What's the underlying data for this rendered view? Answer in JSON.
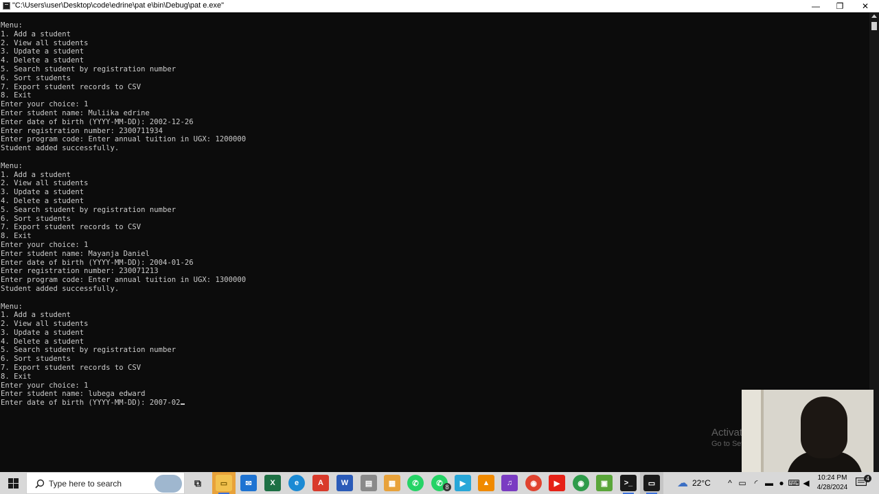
{
  "window": {
    "title": "\"C:\\Users\\user\\Desktop\\code\\edrine\\pat e\\bin\\Debug\\pat e.exe\"",
    "minimize": "—",
    "maximize": "❐",
    "close": "✕"
  },
  "console": {
    "lines": [
      "Menu:",
      "1. Add a student",
      "2. View all students",
      "3. Update a student",
      "4. Delete a student",
      "5. Search student by registration number",
      "6. Sort students",
      "7. Export student records to CSV",
      "8. Exit",
      "Enter your choice: 1",
      "Enter student name: Muliika edrine",
      "Enter date of birth (YYYY-MM-DD): 2002-12-26",
      "Enter registration number: 2300711934",
      "Enter program code: Enter annual tuition in UGX: 1200000",
      "Student added successfully.",
      "",
      "Menu:",
      "1. Add a student",
      "2. View all students",
      "3. Update a student",
      "4. Delete a student",
      "5. Search student by registration number",
      "6. Sort students",
      "7. Export student records to CSV",
      "8. Exit",
      "Enter your choice: 1",
      "Enter student name: Mayanja Daniel",
      "Enter date of birth (YYYY-MM-DD): 2004-01-26",
      "Enter registration number: 230071213",
      "Enter program code: Enter annual tuition in UGX: 1300000",
      "Student added successfully.",
      "",
      "Menu:",
      "1. Add a student",
      "2. View all students",
      "3. Update a student",
      "4. Delete a student",
      "5. Search student by registration number",
      "6. Sort students",
      "7. Export student records to CSV",
      "8. Exit",
      "Enter your choice: 1",
      "Enter student name: lubega edward"
    ],
    "current_input_line": "Enter date of birth (YYYY-MM-DD): 2007-02"
  },
  "watermark": {
    "line1": "Activate Windows",
    "line2": "Go to Settings to activate Windows."
  },
  "taskbar": {
    "search_placeholder": "Type here to search",
    "whatsapp_badge": "8",
    "weather_temp": "22°C",
    "time": "10:24 PM",
    "date": "4/28/2024",
    "notification_count": "4",
    "apps": [
      {
        "name": "task-view",
        "icon": "task-view-icon"
      },
      {
        "name": "file-explorer",
        "icon": "folder-icon",
        "color": "#f2c14e"
      },
      {
        "name": "mail",
        "icon": "mail-icon",
        "color": "#1e73d2"
      },
      {
        "name": "excel",
        "icon": "excel-icon",
        "color": "#1d7044"
      },
      {
        "name": "edge",
        "icon": "edge-icon",
        "color": "#1b8ad4"
      },
      {
        "name": "acrobat",
        "icon": "acrobat-icon",
        "color": "#d93a2b"
      },
      {
        "name": "word",
        "icon": "word-icon",
        "color": "#2b5bb8"
      },
      {
        "name": "store",
        "icon": "store-icon",
        "color": "#e8a23a"
      },
      {
        "name": "whatsapp",
        "icon": "whatsapp-icon",
        "color": "#25d366"
      },
      {
        "name": "whatsapp-business",
        "icon": "whatsapp-business-icon",
        "color": "#25d366"
      },
      {
        "name": "media",
        "icon": "play-icon",
        "color": "#28a7d8"
      },
      {
        "name": "vlc",
        "icon": "vlc-icon",
        "color": "#f08a00"
      },
      {
        "name": "audio",
        "icon": "audio-icon",
        "color": "#7a3cc2"
      },
      {
        "name": "chrome",
        "icon": "chrome-icon",
        "color": "#e0432f"
      },
      {
        "name": "youtube",
        "icon": "youtube-icon",
        "color": "#e62117"
      },
      {
        "name": "chrome-profile",
        "icon": "chrome-profile-icon",
        "color": "#2e9b4a"
      },
      {
        "name": "minecraft",
        "icon": "minecraft-icon",
        "color": "#5aa63a"
      },
      {
        "name": "terminal",
        "icon": "terminal-icon",
        "color": "#1a1a1a"
      },
      {
        "name": "console-window",
        "icon": "console-window-icon",
        "color": "#1a1a1a"
      }
    ]
  }
}
